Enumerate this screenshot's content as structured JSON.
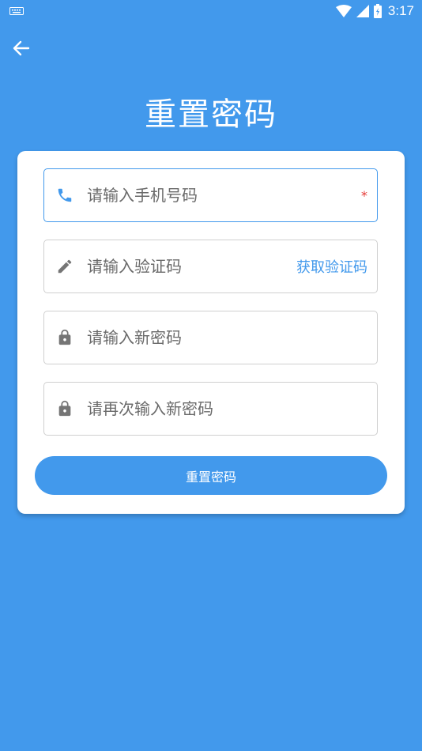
{
  "status_bar": {
    "time": "3:17",
    "icons": [
      "keyboard-icon",
      "wifi-icon",
      "signal-icon",
      "battery-icon"
    ]
  },
  "header": {
    "back_icon": "arrow-left-icon",
    "title": "重置密码"
  },
  "form": {
    "phone": {
      "placeholder": "请输入手机号码",
      "value": "",
      "icon": "phone-icon",
      "required_mark": "*"
    },
    "code": {
      "placeholder": "请输入验证码",
      "value": "",
      "icon": "pencil-icon",
      "action_label": "获取验证码"
    },
    "new_password": {
      "placeholder": "请输入新密码",
      "value": "",
      "icon": "lock-icon"
    },
    "confirm_password": {
      "placeholder": "请再次输入新密码",
      "value": "",
      "icon": "lock-icon"
    },
    "submit_label": "重置密码"
  },
  "colors": {
    "primary": "#4299ec",
    "icon_active": "#4299ec",
    "icon_default": "#757575",
    "required": "#e53935"
  }
}
